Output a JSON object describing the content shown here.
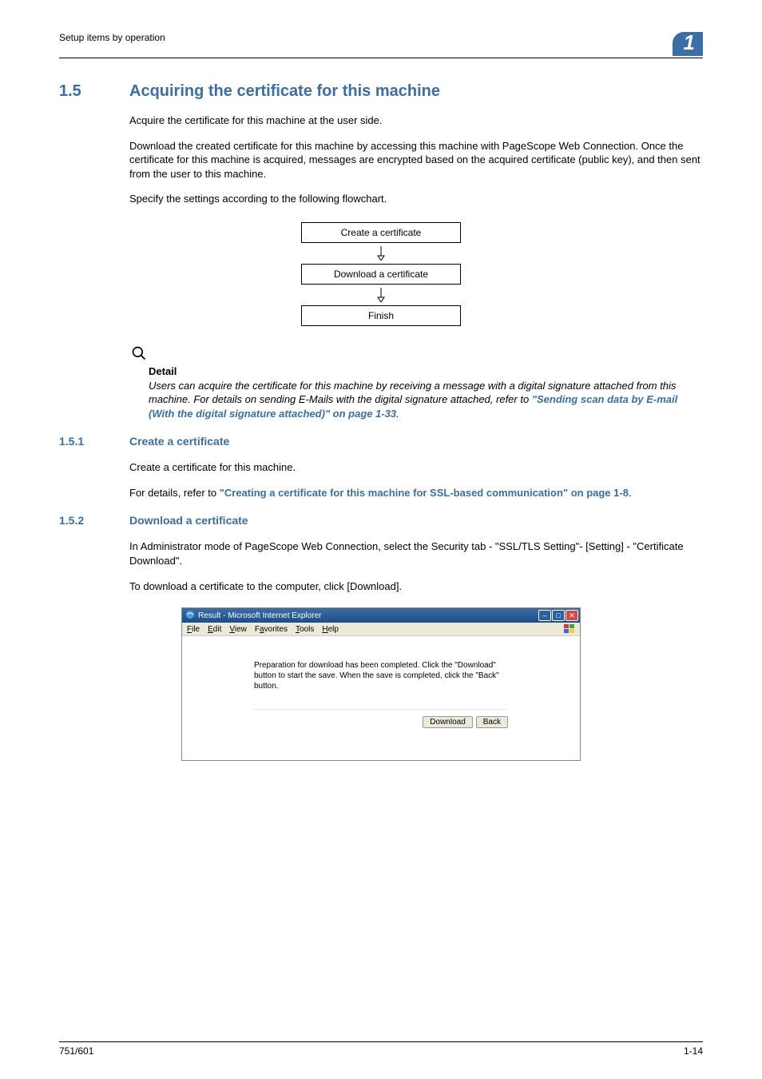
{
  "header": {
    "left": "Setup items by operation",
    "chapter": "1"
  },
  "section": {
    "num": "1.5",
    "title": "Acquiring the certificate for this machine",
    "p1": "Acquire the certificate for this machine at the user side.",
    "p2": "Download the created certificate for this machine by accessing this machine with PageScope Web Connection. Once the certificate for this machine is acquired, messages are encrypted based on the acquired certificate (public key), and then sent from the user to this machine.",
    "p3": "Specify the settings according to the following flowchart."
  },
  "flow": {
    "s1": "Create a certificate",
    "s2": "Download a certificate",
    "s3": "Finish"
  },
  "detail": {
    "label": "Detail",
    "text": "Users can acquire the certificate for this machine by receiving a message with a digital signature attached from this machine. For details on sending E-Mails with the digital signature attached, refer to ",
    "link": "\"Sending scan data by E-mail (With the digital signature attached)\" on page 1-33",
    "period": "."
  },
  "sub1": {
    "num": "1.5.1",
    "title": "Create a certificate",
    "p1": "Create a certificate for this machine.",
    "p2_pre": "For details, refer to ",
    "p2_link": "\"Creating a certificate for this machine for SSL-based communication\" on page 1-8",
    "p2_post": "."
  },
  "sub2": {
    "num": "1.5.2",
    "title": "Download a certificate",
    "p1": "In Administrator mode of PageScope Web Connection, select the Security tab - \"SSL/TLS Setting\"- [Setting] - \"Certificate Download\".",
    "p2": "To download a certificate to the computer, click [Download]."
  },
  "ie": {
    "title": "Result - Microsoft Internet Explorer",
    "menu": {
      "file": "File",
      "edit": "Edit",
      "view": "View",
      "favorites": "Favorites",
      "tools": "Tools",
      "help": "Help"
    },
    "message": "Preparation for download has been completed. Click the \"Download\" button to start the save. When the save is completed, click the \"Back\" button.",
    "btn_download": "Download",
    "btn_back": "Back"
  },
  "footer": {
    "left": "751/601",
    "right": "1-14"
  }
}
